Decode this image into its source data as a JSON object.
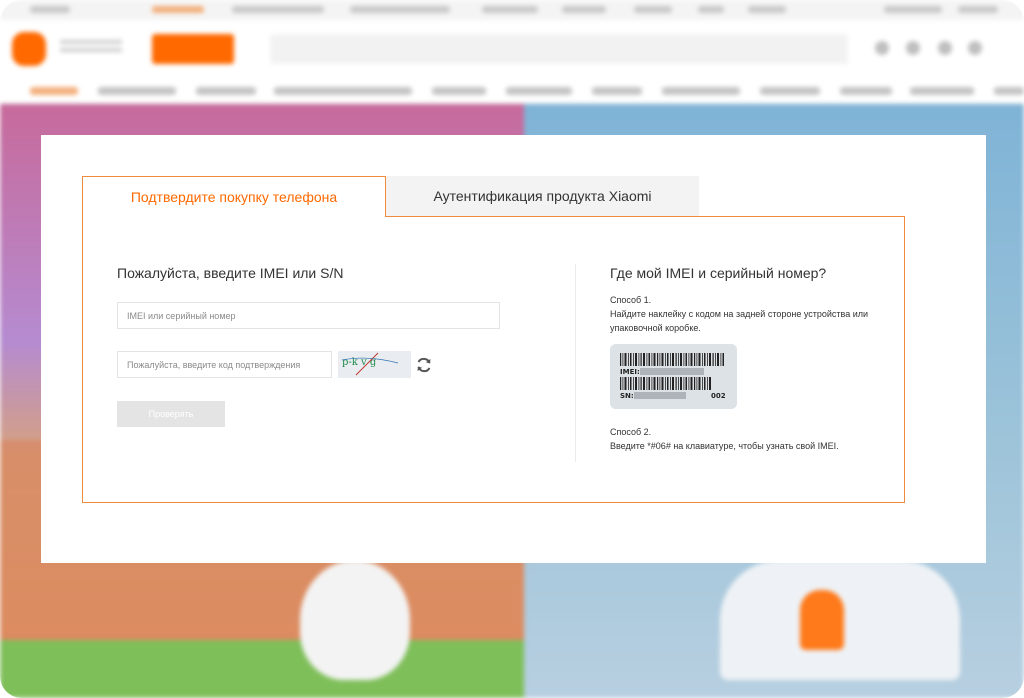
{
  "tabs": {
    "active": "Подтвердите покупку телефона",
    "inactive": "Аутентификация продукта Xiaomi"
  },
  "verify_form": {
    "title": "Пожалуйста, введите IMEI или S/N",
    "imei_placeholder": "IMEI или серийный номер",
    "code_placeholder": "Пожалуйста, введите код подтверждения",
    "captcha_text": "p-k v g",
    "verify_label": "Проверять"
  },
  "help": {
    "title": "Где мой IMEI и серийный номер?",
    "method1_heading": "Способ 1.",
    "method1_text": "Найдите наклейку с кодом на задней стороне устройства или упаковочной коробке.",
    "method2_heading": "Способ 2.",
    "method2_text": "Введите *#06# на клавиатуре, чтобы узнать свой IMEI.",
    "label_imei_prefix": "IMEI:",
    "label_sn_prefix": "SN:",
    "label_code": "002"
  },
  "colors": {
    "accent": "#ff6900",
    "border": "#f08a3c"
  }
}
